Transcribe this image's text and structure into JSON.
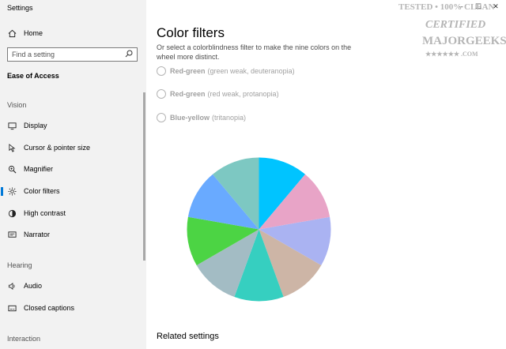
{
  "window": {
    "title": "Settings",
    "controls": [
      "–",
      "☐",
      "✕"
    ]
  },
  "sidebar": {
    "home_label": "Home",
    "search_placeholder": "Find a setting",
    "section_title": "Ease of Access",
    "groups": {
      "vision": "Vision",
      "hearing": "Hearing",
      "interaction": "Interaction"
    },
    "items": [
      {
        "label": "Display",
        "icon": "display-icon"
      },
      {
        "label": "Cursor & pointer size",
        "icon": "cursor-icon"
      },
      {
        "label": "Magnifier",
        "icon": "magnifier-icon"
      },
      {
        "label": "Color filters",
        "icon": "color-filters-icon",
        "selected": true
      },
      {
        "label": "High contrast",
        "icon": "high-contrast-icon"
      },
      {
        "label": "Narrator",
        "icon": "narrator-icon"
      },
      {
        "label": "Audio",
        "icon": "audio-icon"
      },
      {
        "label": "Closed captions",
        "icon": "closed-captions-icon"
      }
    ],
    "accent_color": "#0078d7"
  },
  "main": {
    "title": "Color filters",
    "description": "Or select a colorblindness filter to make the nine colors on the wheel more distinct.",
    "options": [
      {
        "bold": "Red-green",
        "detail": "(green weak, deuteranopia)"
      },
      {
        "bold": "Red-green",
        "detail": "(red weak, protanopia)"
      },
      {
        "bold": "Blue-yellow",
        "detail": "(tritanopia)"
      }
    ],
    "wheel_colors": [
      "#aab3f2",
      "#cdb5a6",
      "#36cfc0",
      "#a3bcc4",
      "#4cd444",
      "#69aaff",
      "#7dc8c2",
      "#00c4ff",
      "#e8a4c7"
    ],
    "related_settings": "Related settings"
  },
  "watermark": {
    "line1": "TESTED • 100% CLEAN",
    "line2": "CERTIFIED",
    "line3": "MAJORGEEKS",
    "line4": "★★★★★★ .COM"
  }
}
